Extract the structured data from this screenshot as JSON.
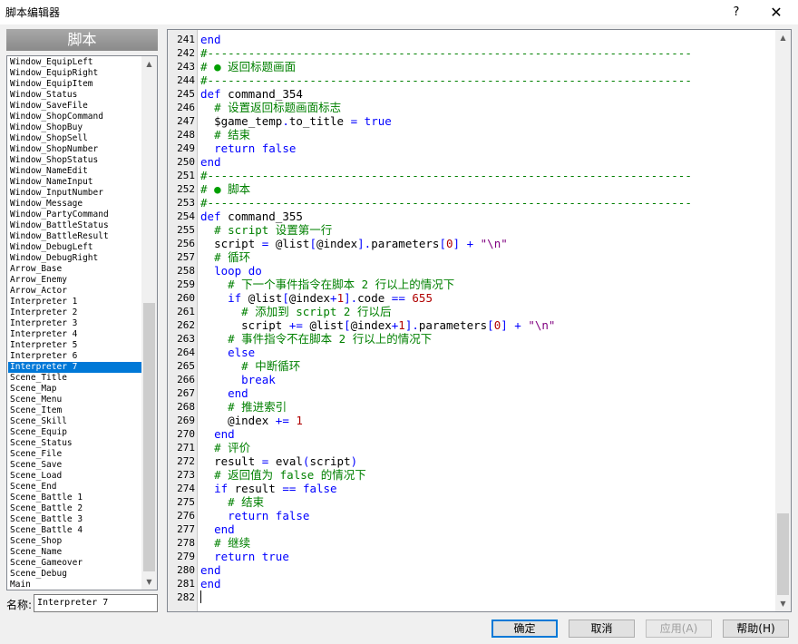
{
  "window": {
    "title": "脚本编辑器",
    "help_glyph": "?",
    "close_glyph": "✕"
  },
  "left_panel": {
    "header": "脚本",
    "scripts": [
      "Window_EquipLeft",
      "Window_EquipRight",
      "Window_EquipItem",
      "Window_Status",
      "Window_SaveFile",
      "Window_ShopCommand",
      "Window_ShopBuy",
      "Window_ShopSell",
      "Window_ShopNumber",
      "Window_ShopStatus",
      "Window_NameEdit",
      "Window_NameInput",
      "Window_InputNumber",
      "Window_Message",
      "Window_PartyCommand",
      "Window_BattleStatus",
      "Window_BattleResult",
      "Window_DebugLeft",
      "Window_DebugRight",
      "Arrow_Base",
      "Arrow_Enemy",
      "Arrow_Actor",
      "Interpreter 1",
      "Interpreter 2",
      "Interpreter 3",
      "Interpreter 4",
      "Interpreter 5",
      "Interpreter 6",
      "Interpreter 7",
      "Scene_Title",
      "Scene_Map",
      "Scene_Menu",
      "Scene_Item",
      "Scene_Skill",
      "Scene_Equip",
      "Scene_Status",
      "Scene_File",
      "Scene_Save",
      "Scene_Load",
      "Scene_End",
      "Scene_Battle 1",
      "Scene_Battle 2",
      "Scene_Battle 3",
      "Scene_Battle 4",
      "Scene_Shop",
      "Scene_Name",
      "Scene_Gameover",
      "Scene_Debug",
      "Main"
    ],
    "selected": "Interpreter 7",
    "name_label": "名称:",
    "name_value": "Interpreter 7"
  },
  "editor": {
    "lines": [
      {
        "n": "241",
        "t": "end"
      },
      {
        "n": "242",
        "t": "#-----------------------------------------------------------------------"
      },
      {
        "n": "243",
        "t": "# ● 返回标题画面"
      },
      {
        "n": "244",
        "t": "#-----------------------------------------------------------------------"
      },
      {
        "n": "245",
        "t": "def command_354"
      },
      {
        "n": "246",
        "t": "  # 设置返回标题画面标志"
      },
      {
        "n": "247",
        "t": "  $game_temp.to_title = true"
      },
      {
        "n": "248",
        "t": "  # 结束"
      },
      {
        "n": "249",
        "t": "  return false"
      },
      {
        "n": "250",
        "t": "end"
      },
      {
        "n": "251",
        "t": "#-----------------------------------------------------------------------"
      },
      {
        "n": "252",
        "t": "# ● 脚本"
      },
      {
        "n": "253",
        "t": "#-----------------------------------------------------------------------"
      },
      {
        "n": "254",
        "t": "def command_355"
      },
      {
        "n": "255",
        "t": "  # script 设置第一行"
      },
      {
        "n": "256",
        "t": "  script = @list[@index].parameters[0] + \"\\n\""
      },
      {
        "n": "257",
        "t": "  # 循环"
      },
      {
        "n": "258",
        "t": "  loop do"
      },
      {
        "n": "259",
        "t": "    # 下一个事件指令在脚本 2 行以上的情况下"
      },
      {
        "n": "260",
        "t": "    if @list[@index+1].code == 655"
      },
      {
        "n": "261",
        "t": "      # 添加到 script 2 行以后"
      },
      {
        "n": "262",
        "t": "      script += @list[@index+1].parameters[0] + \"\\n\""
      },
      {
        "n": "263",
        "t": "    # 事件指令不在脚本 2 行以上的情况下"
      },
      {
        "n": "264",
        "t": "    else"
      },
      {
        "n": "265",
        "t": "      # 中断循环"
      },
      {
        "n": "266",
        "t": "      break"
      },
      {
        "n": "267",
        "t": "    end"
      },
      {
        "n": "268",
        "t": "    # 推进索引"
      },
      {
        "n": "269",
        "t": "    @index += 1"
      },
      {
        "n": "270",
        "t": "  end"
      },
      {
        "n": "271",
        "t": "  # 评价"
      },
      {
        "n": "272",
        "t": "  result = eval(script)"
      },
      {
        "n": "273",
        "t": "  # 返回值为 false 的情况下"
      },
      {
        "n": "274",
        "t": "  if result == false"
      },
      {
        "n": "275",
        "t": "    # 结束"
      },
      {
        "n": "276",
        "t": "    return false"
      },
      {
        "n": "277",
        "t": "  end"
      },
      {
        "n": "278",
        "t": "  # 继续"
      },
      {
        "n": "279",
        "t": "  return true"
      },
      {
        "n": "280",
        "t": "end"
      },
      {
        "n": "281",
        "t": "end"
      },
      {
        "n": "282",
        "t": ""
      }
    ]
  },
  "buttons": {
    "ok": "确定",
    "cancel": "取消",
    "apply": "应用(A)",
    "help": "帮助(H)"
  },
  "colors": {
    "selection": "#0078d7",
    "keyword": "#0000ff",
    "comment": "#008000",
    "string": "#800080",
    "number": "#b00000"
  }
}
